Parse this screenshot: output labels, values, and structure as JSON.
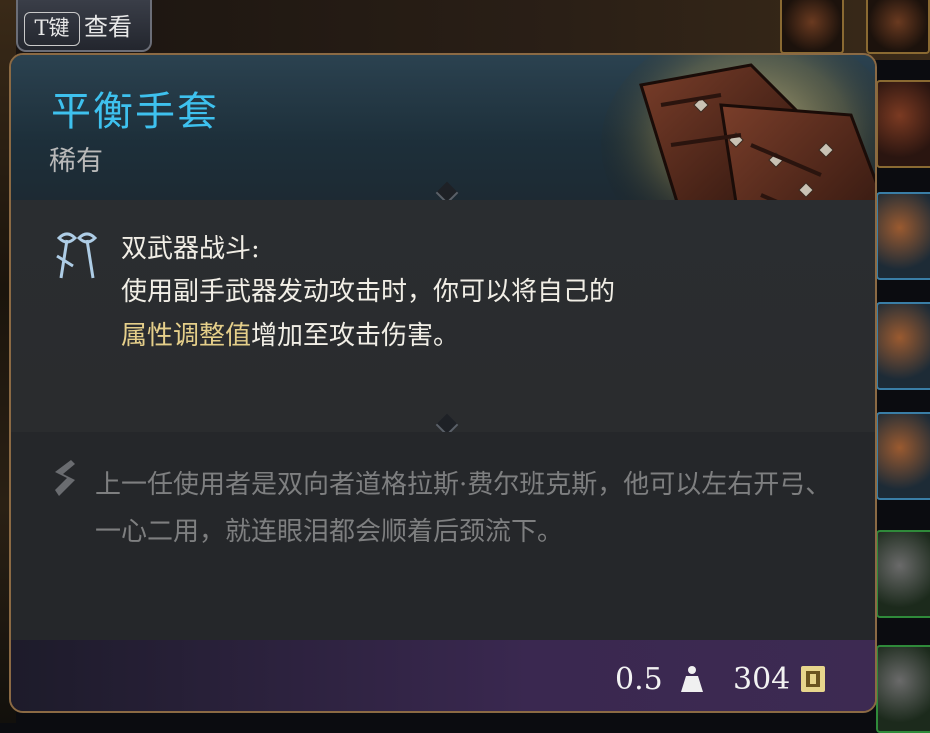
{
  "hint": {
    "key": "T键",
    "label": "查看"
  },
  "item": {
    "name": "平衡手套",
    "rarity": "稀有",
    "feature": {
      "title": "双武器战斗:",
      "desc_before": "使用副手武器发动攻击时，你可以将自己的",
      "desc_highlight": "属性调整值",
      "desc_after": "增加至攻击伤害。"
    },
    "flavor": "上一任使用者是双向者道格拉斯·费尔班克斯，他可以左右开弓、一心二用，就连眼泪都会顺着后颈流下。",
    "weight": "0.5",
    "price": "304"
  },
  "icons": [
    "gloves-icon",
    "dual-wield-icon",
    "flavor-quill-icon",
    "weight-icon",
    "gold-coin-icon"
  ],
  "colors": {
    "title": "#3ec1ee",
    "highlight": "#e5cf8a",
    "frame": "#8b6a44"
  }
}
